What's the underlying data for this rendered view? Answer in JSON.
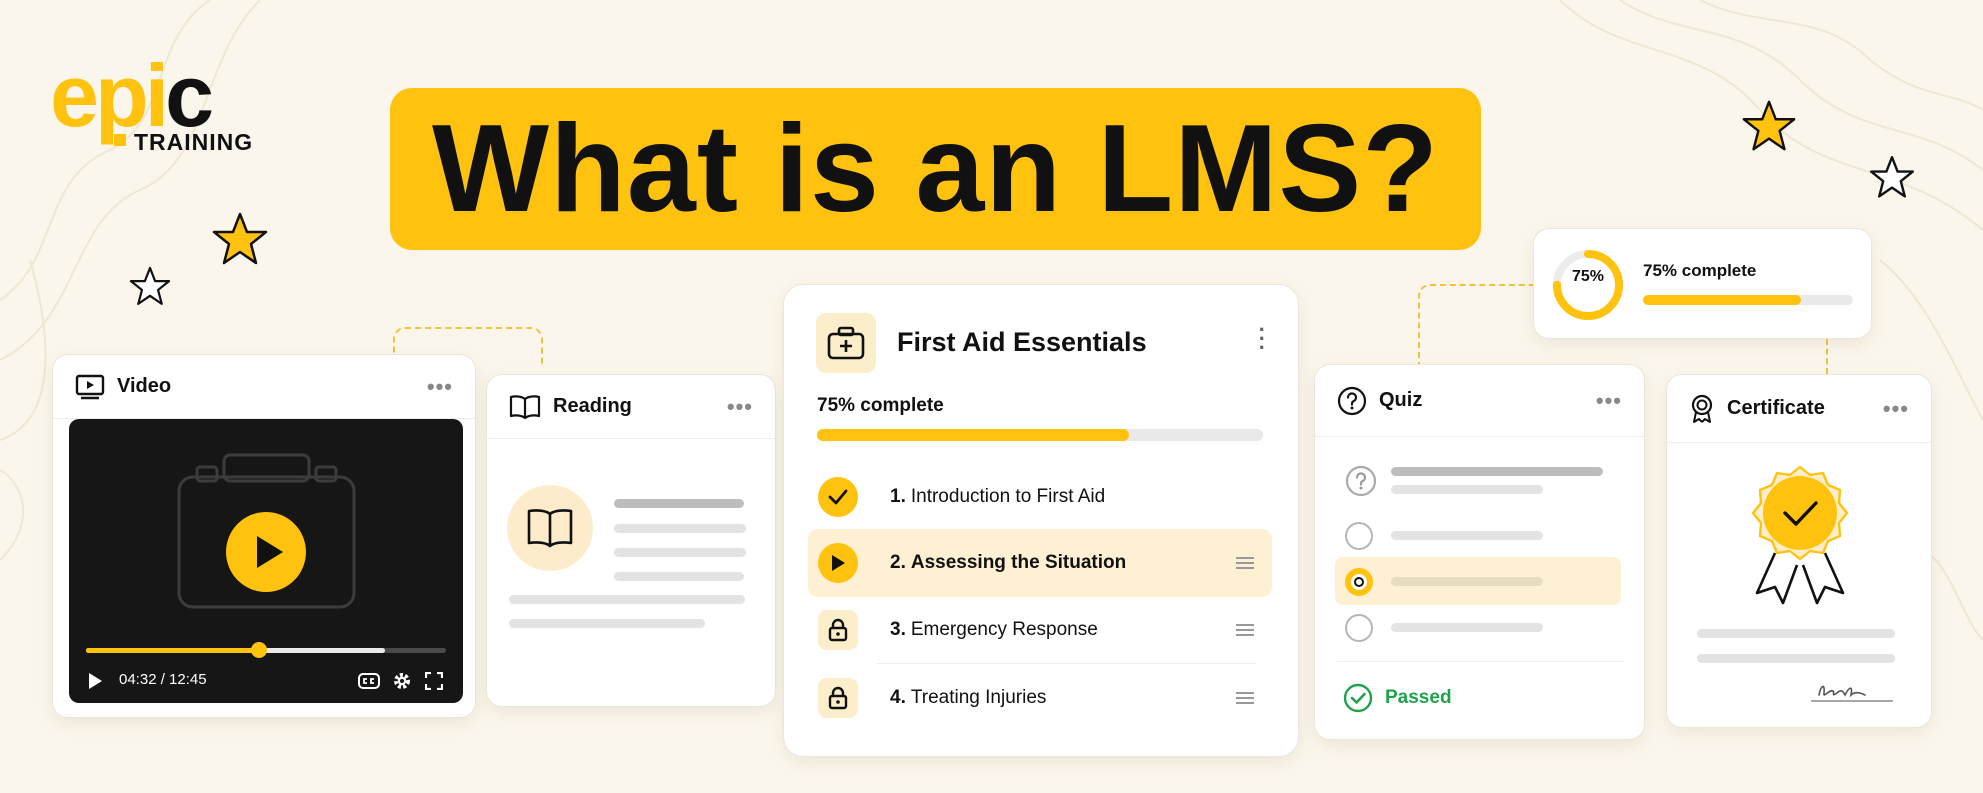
{
  "brand": {
    "logo_e": "e",
    "logo_p": "p",
    "logo_i": "i",
    "logo_c": "c",
    "logo_sub": "TRAINING",
    "accent": "#ffc20e",
    "success": "#1fa34a"
  },
  "headline": "What is an LMS?",
  "video_card": {
    "title": "Video",
    "time": "04:32 / 12:45",
    "played_fraction": 0.48,
    "buffered_fraction": 0.83
  },
  "reading_card": {
    "title": "Reading"
  },
  "course_card": {
    "title": "First Aid Essentials",
    "progress_label": "75% complete",
    "progress_fraction": 0.7,
    "lessons": [
      {
        "num": "1.",
        "label": "Introduction to First Aid",
        "status": "completed"
      },
      {
        "num": "2.",
        "label": "Assessing the Situation",
        "status": "in-progress"
      },
      {
        "num": "3.",
        "label": "Emergency Response",
        "status": "locked"
      },
      {
        "num": "4.",
        "label": "Treating Injuries",
        "status": "locked"
      }
    ]
  },
  "progress_card": {
    "ring_label": "75%",
    "label": "75% complete",
    "fraction": 0.75
  },
  "quiz_card": {
    "title": "Quiz",
    "selected_option": 3,
    "result": "Passed"
  },
  "certificate_card": {
    "title": "Certificate"
  }
}
